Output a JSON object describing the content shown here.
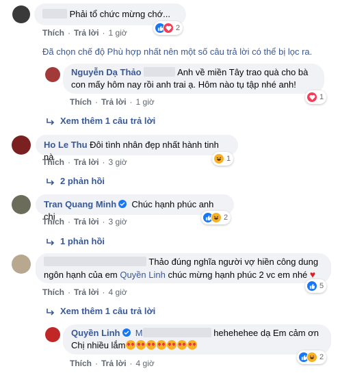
{
  "actions": {
    "like": "Thích",
    "reply": "Trả lời",
    "sep": "·"
  },
  "comments": [
    {
      "text": "Phải tổ chức mừng chớ...",
      "time": "1 giờ",
      "reaction_count": "2"
    },
    {
      "filter_note": "Đã chọn chế độ Phù hợp nhất nên một số câu trả lời có thể bị lọc ra."
    },
    {
      "name": "Nguyễn Dạ Thảo",
      "text_line1": "Anh về miền Tây trao quà cho bà",
      "text_line2": "con mấy hôm nay rồi anh trai ạ. Hôm nào tụ tập nhé anh!",
      "time": "1 giờ",
      "reaction_count": "1"
    },
    {
      "more": "Xem thêm 1 câu trả lời"
    },
    {
      "name": "Ho Le Thu",
      "text": "Đôi tình nhân đẹp nhất hành tinh nà",
      "time": "3 giờ",
      "reaction_count": "1"
    },
    {
      "more": "2 phản hồi"
    },
    {
      "name": "Tran Quang Minh",
      "text": "Chúc hạnh phúc anh chị",
      "time": "3 giờ",
      "reaction_count": "2"
    },
    {
      "more": "1 phản hồi"
    },
    {
      "text_line1": "Thảo đúng nghĩa người vợ hiền công dung",
      "text_line2a": "ngôn hạnh của em",
      "mention": "Quyền Linh",
      "text_line2b": "chúc mừng hạnh phúc 2 vc em nhé",
      "time": "4 giờ",
      "reaction_count": "5"
    },
    {
      "more": "Xem thêm 1 câu trả lời"
    },
    {
      "name": "Quyền Linh",
      "initial": "M",
      "text_line1": "hehehehee dạ Em cảm ơn",
      "text_line2": "Chị nhiều lắm",
      "time": "4 giờ",
      "reaction_count": "2"
    }
  ]
}
